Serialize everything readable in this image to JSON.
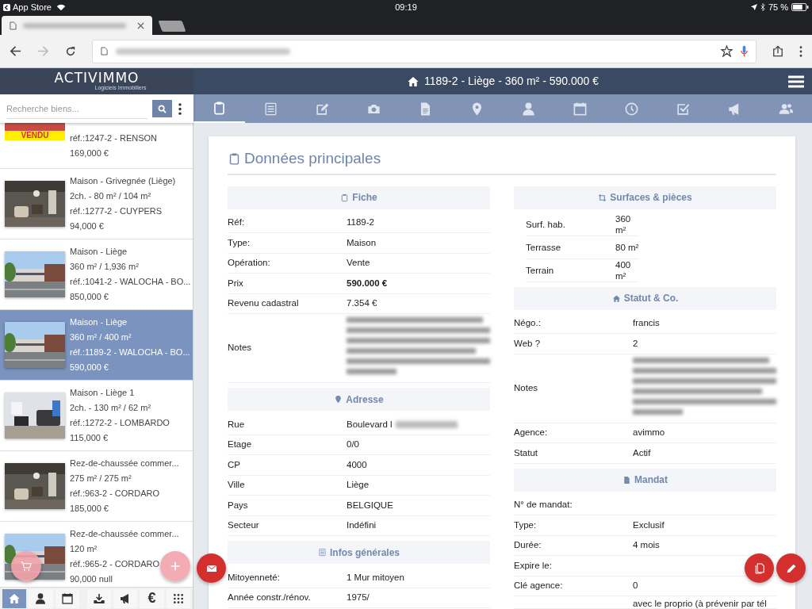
{
  "status_bar": {
    "back_app": "App Store",
    "time": "09:19",
    "battery": "75 %"
  },
  "browser": {
    "tabs": [
      {
        "kind": "page",
        "selected": true
      },
      {
        "kind": "empty",
        "selected": false
      }
    ]
  },
  "app_header": {
    "logo": "ACTIVIMMO",
    "tagline": "Logiciels Immobiliers",
    "title": "1189-2 - Liège - 360 m² - 590.000 €"
  },
  "search": {
    "placeholder": "Recherche biens..."
  },
  "tabs": [
    {
      "kind": "clipboard",
      "selected": true
    },
    {
      "kind": "list",
      "selected": false
    },
    {
      "kind": "edit",
      "selected": false
    },
    {
      "kind": "camera",
      "selected": false
    },
    {
      "kind": "file",
      "selected": false
    },
    {
      "kind": "pin",
      "selected": false
    },
    {
      "kind": "user",
      "selected": false
    },
    {
      "kind": "calendar",
      "selected": false
    },
    {
      "kind": "clock",
      "selected": false
    },
    {
      "kind": "check",
      "selected": false
    },
    {
      "kind": "megaphone",
      "selected": false
    },
    {
      "kind": "users",
      "selected": false
    }
  ],
  "listings": [
    {
      "badge": "VENDU",
      "lines": [
        "réf.:1247-2 - RENSON"
      ],
      "price": "169,000 €",
      "selected": false,
      "partial": true
    },
    {
      "lines": [
        "Maison - Grivegnée (Liège)",
        "2ch. - 80 m² / 104 m²",
        "réf.:1277-2 - CUYPERS"
      ],
      "price": "94,000 €",
      "selected": false
    },
    {
      "lines": [
        "Maison - Liège",
        "360 m² / 1,936 m²",
        "réf.:1041-2 - WALOCHA - BO..."
      ],
      "price": "850,000 €",
      "selected": false
    },
    {
      "lines": [
        "Maison - Liège",
        "360 m² / 400 m²",
        "réf.:1189-2 - WALOCHA - BO..."
      ],
      "price": "590,000 €",
      "selected": true
    },
    {
      "lines": [
        "Maison - Liège 1",
        "2ch. - 130 m² / 62 m²",
        "réf.:1272-2 - LOMBARDO"
      ],
      "price": "115,000 €",
      "selected": false
    },
    {
      "lines": [
        "Rez-de-chaussée commer...",
        "275 m² / 275 m²",
        "réf.:963-2 - CORDARO"
      ],
      "price": "185,000 €",
      "selected": false
    },
    {
      "lines": [
        "Rez-de-chaussée commer...",
        "120 m²",
        "réf.:965-2 - CORDARO"
      ],
      "price": "90,000 null",
      "selected": false
    }
  ],
  "main": {
    "title": "Données principales",
    "left": [
      {
        "title": "Fiche",
        "kind": "clipboard",
        "rows": [
          {
            "label": "Réf:",
            "value": "1189-2",
            "kind": "text"
          },
          {
            "label": "Type:",
            "value": "Maison",
            "kind": "text"
          },
          {
            "label": "Opération:",
            "value": "Vente",
            "kind": "text"
          },
          {
            "label": "Prix",
            "value": "590.000 €",
            "kind": "bold"
          },
          {
            "label": "Revenu cadastral",
            "value": "7.354 €",
            "kind": "text"
          },
          {
            "label": "Notes",
            "kind": "blurred"
          }
        ]
      },
      {
        "title": "Adresse",
        "kind": "pin",
        "rows": [
          {
            "label": "Rue",
            "value": "Boulevard l",
            "kind": "partly_blurred"
          },
          {
            "label": "Etage",
            "value": "0/0",
            "kind": "text"
          },
          {
            "label": "CP",
            "value": "4000",
            "kind": "text"
          },
          {
            "label": "Ville",
            "value": "Liège",
            "kind": "text"
          },
          {
            "label": "Pays",
            "value": "BELGIQUE",
            "kind": "text"
          },
          {
            "label": "Secteur",
            "value": "Indéfini",
            "kind": "text"
          }
        ]
      },
      {
        "title": "Infos générales",
        "kind": "list",
        "rows": [
          {
            "label": "Mitoyenneté:",
            "value": "1 Mur mitoyen",
            "kind": "text"
          },
          {
            "label": "Année constr./rénov.",
            "value": "1975/",
            "kind": "text"
          }
        ]
      }
    ],
    "right": [
      {
        "title": "Surfaces & pièces",
        "kind": "crop",
        "compact": true,
        "rows": [
          {
            "label": "Surf. hab.",
            "value": "360 m²",
            "kind": "text"
          },
          {
            "label": "Terrasse",
            "value": "80 m²",
            "kind": "text"
          },
          {
            "label": "Terrain",
            "value": "400 m²",
            "kind": "text"
          }
        ]
      },
      {
        "title": "Statut & Co.",
        "kind": "home",
        "rows": [
          {
            "label": "Négo.:",
            "value": "francis",
            "kind": "text"
          },
          {
            "label": "Web ?",
            "value": "2",
            "kind": "text"
          },
          {
            "label": "Notes",
            "kind": "blurred"
          },
          {
            "label": "Agence:",
            "value": "avimmo",
            "kind": "text"
          },
          {
            "label": "Statut",
            "value": "Actif",
            "kind": "text"
          }
        ]
      },
      {
        "title": "Mandat",
        "kind": "file",
        "rows": [
          {
            "label": "N° de mandat:",
            "kind": "text"
          },
          {
            "label": "Type:",
            "value": "Exclusif",
            "kind": "text"
          },
          {
            "label": "Durée:",
            "value": "4 mois",
            "kind": "text"
          },
          {
            "label": "Expire le:",
            "kind": "text"
          },
          {
            "label": "Clé agence:",
            "value": "0",
            "kind": "text"
          },
          {
            "value": "avec le proprio (à prévenir par tél",
            "kind": "text"
          }
        ]
      }
    ]
  },
  "fabs": [
    {
      "kind": "cart",
      "faded": true
    },
    {
      "kind": "plus",
      "faded": true
    },
    {
      "kind": "mail",
      "faded": false
    },
    {
      "kind": "copy",
      "faded": false
    },
    {
      "kind": "pencil",
      "faded": false
    }
  ],
  "bottom_nav": [
    {
      "kind": "home",
      "selected": true
    },
    {
      "kind": "user",
      "selected": false
    },
    {
      "kind": "calendar",
      "selected": false
    },
    {
      "kind": "download",
      "selected": false
    },
    {
      "kind": "megaphone",
      "selected": false
    },
    {
      "kind": "text",
      "label": "€",
      "selected": false
    },
    {
      "kind": "grid",
      "selected": false
    }
  ]
}
